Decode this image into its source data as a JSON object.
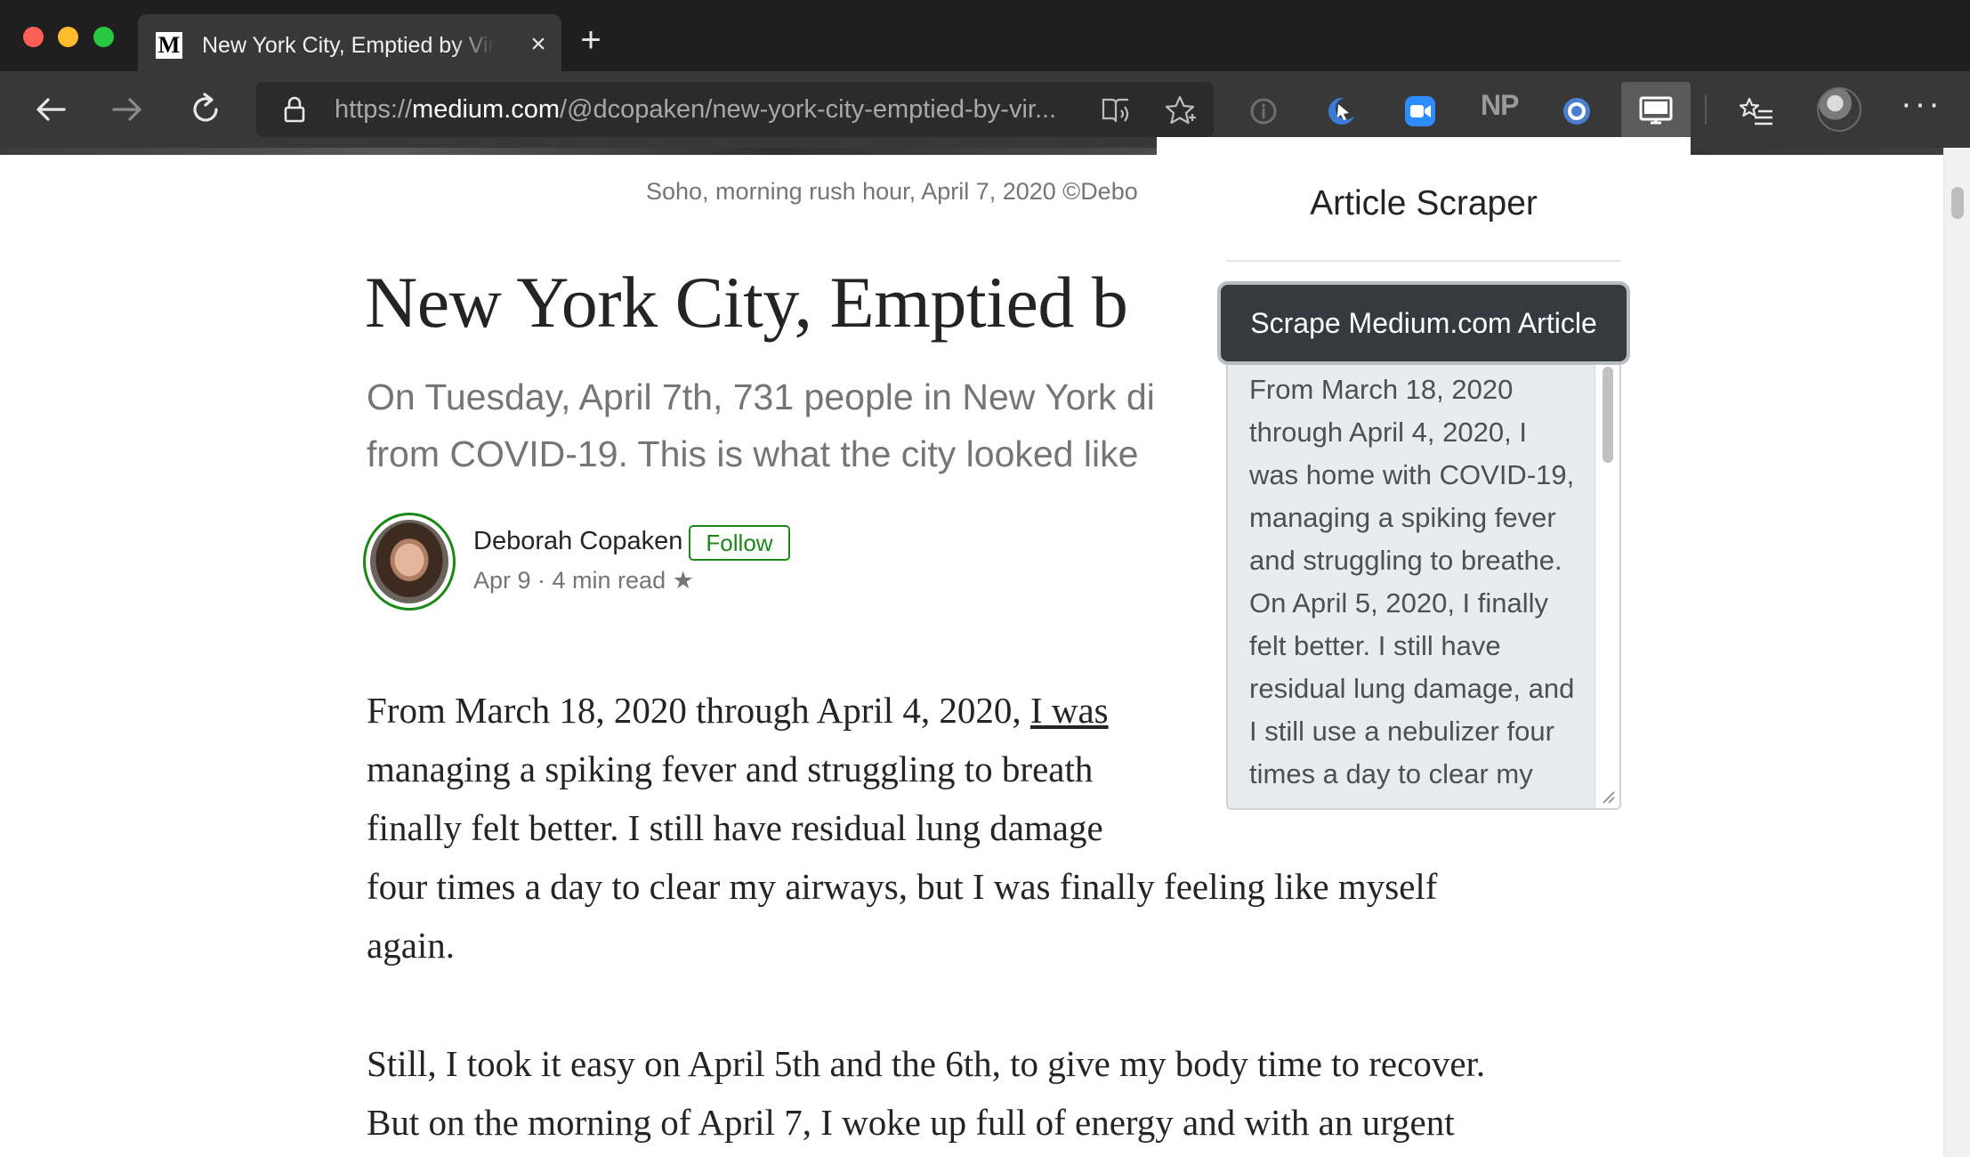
{
  "browser": {
    "tab": {
      "favicon_letter": "M",
      "title": "New York City, Emptied by Virus",
      "close_glyph": "×"
    },
    "new_tab_glyph": "+",
    "url_scheme": "https://",
    "url_host": "medium.com",
    "url_path": "/@dcopaken/new-york-city-emptied-by-vir...",
    "extensions": [
      "info-icon",
      "cursor-moon-icon",
      "zoom-icon",
      "np-extension",
      "circle-extension-icon",
      "article-scraper-icon"
    ],
    "np_label": "NP",
    "more_glyph": "···"
  },
  "article": {
    "caption": "Soho, morning rush hour, April 7, 2020 ©Debo",
    "title": "New York City, Emptied b",
    "subtitle_lines": [
      "On Tuesday, April 7th, 731 people in New York di",
      "from COVID-19. This is what the city looked like"
    ],
    "author": {
      "name": "Deborah Copaken",
      "follow_label": "Follow",
      "meta": "Apr 9 · 4 min read ★"
    },
    "paragraph1": {
      "line1_plain": "From March 18, 2020 through April 4, 2020, ",
      "line1_link": "I was",
      "line2": "managing a spiking fever and struggling to breath",
      "line3": "finally felt better. I still have residual lung damage",
      "line4": "four times a day to clear my airways, but I was finally feeling like myself",
      "line5": "again."
    },
    "paragraph2": {
      "line1": "Still, I took it easy on April 5th and the 6th, to give my body time to recover.",
      "line2": "But on the morning of April 7, I woke up full of energy and with an urgent"
    }
  },
  "popup": {
    "title": "Article Scraper",
    "button_label": "Scrape Medium.com Article",
    "output_lines": [
      "From March 18, 2020",
      "through April 4, 2020, I",
      "was home with COVID-19,",
      "managing a spiking fever",
      "and struggling to breathe.",
      "On April 5, 2020, I finally",
      "felt better. I still have",
      "residual lung damage, and",
      "I still use a nebulizer four",
      "times a day to clear my"
    ]
  }
}
